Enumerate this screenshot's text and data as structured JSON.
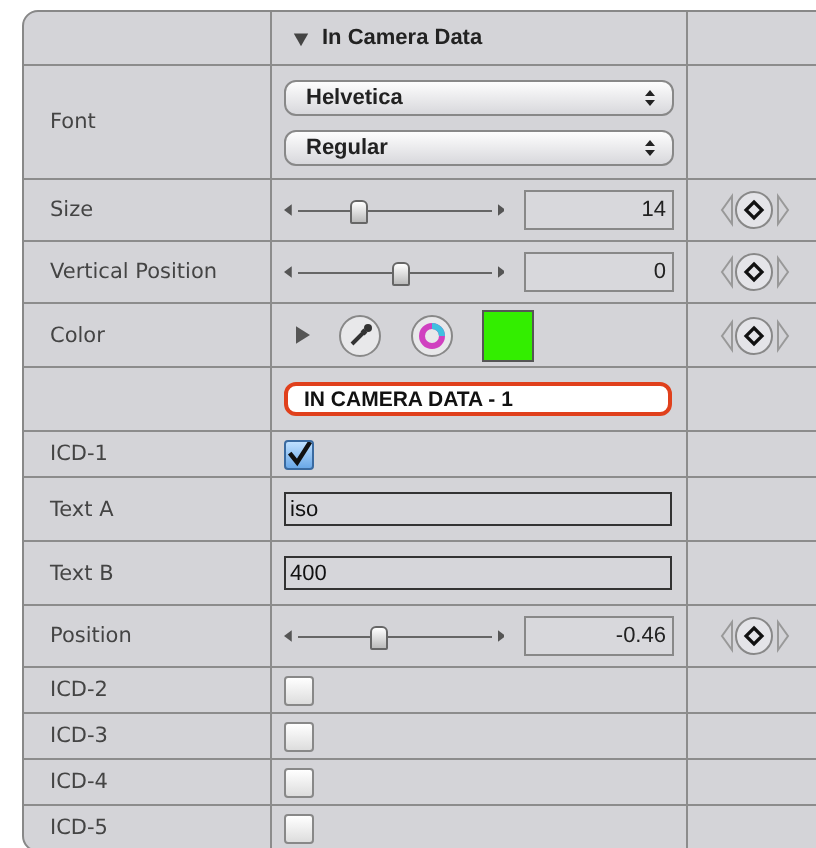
{
  "header": {
    "title": "In Camera Data",
    "expanded": true
  },
  "rows": [
    {
      "kind": "popups",
      "label": "Font",
      "options": [
        "Helvetica",
        "Regular"
      ]
    },
    {
      "kind": "slider",
      "label": "Size",
      "level": 0.3,
      "value": "14",
      "keyframe": true
    },
    {
      "kind": "slider",
      "label": "Vertical Position",
      "level": 0.52,
      "value": "0",
      "keyframe": true
    },
    {
      "kind": "color",
      "label": "Color",
      "color": "#33ee00",
      "expanded": false,
      "keyframe": true
    },
    {
      "kind": "title",
      "value": "IN CAMERA DATA - 1"
    },
    {
      "kind": "checkbox",
      "label": "ICD-1",
      "checked": true
    },
    {
      "kind": "text",
      "label": "Text A",
      "value": "iso"
    },
    {
      "kind": "text",
      "label": "Text B",
      "value": "400"
    },
    {
      "kind": "slider",
      "label": "Position",
      "level": 0.4,
      "value": "-0.46",
      "keyframe": true
    },
    {
      "kind": "checkbox",
      "label": "ICD-2",
      "checked": false
    },
    {
      "kind": "checkbox",
      "label": "ICD-3",
      "checked": false
    },
    {
      "kind": "checkbox",
      "label": "ICD-4",
      "checked": false
    },
    {
      "kind": "checkbox",
      "label": "ICD-5",
      "checked": false
    }
  ]
}
